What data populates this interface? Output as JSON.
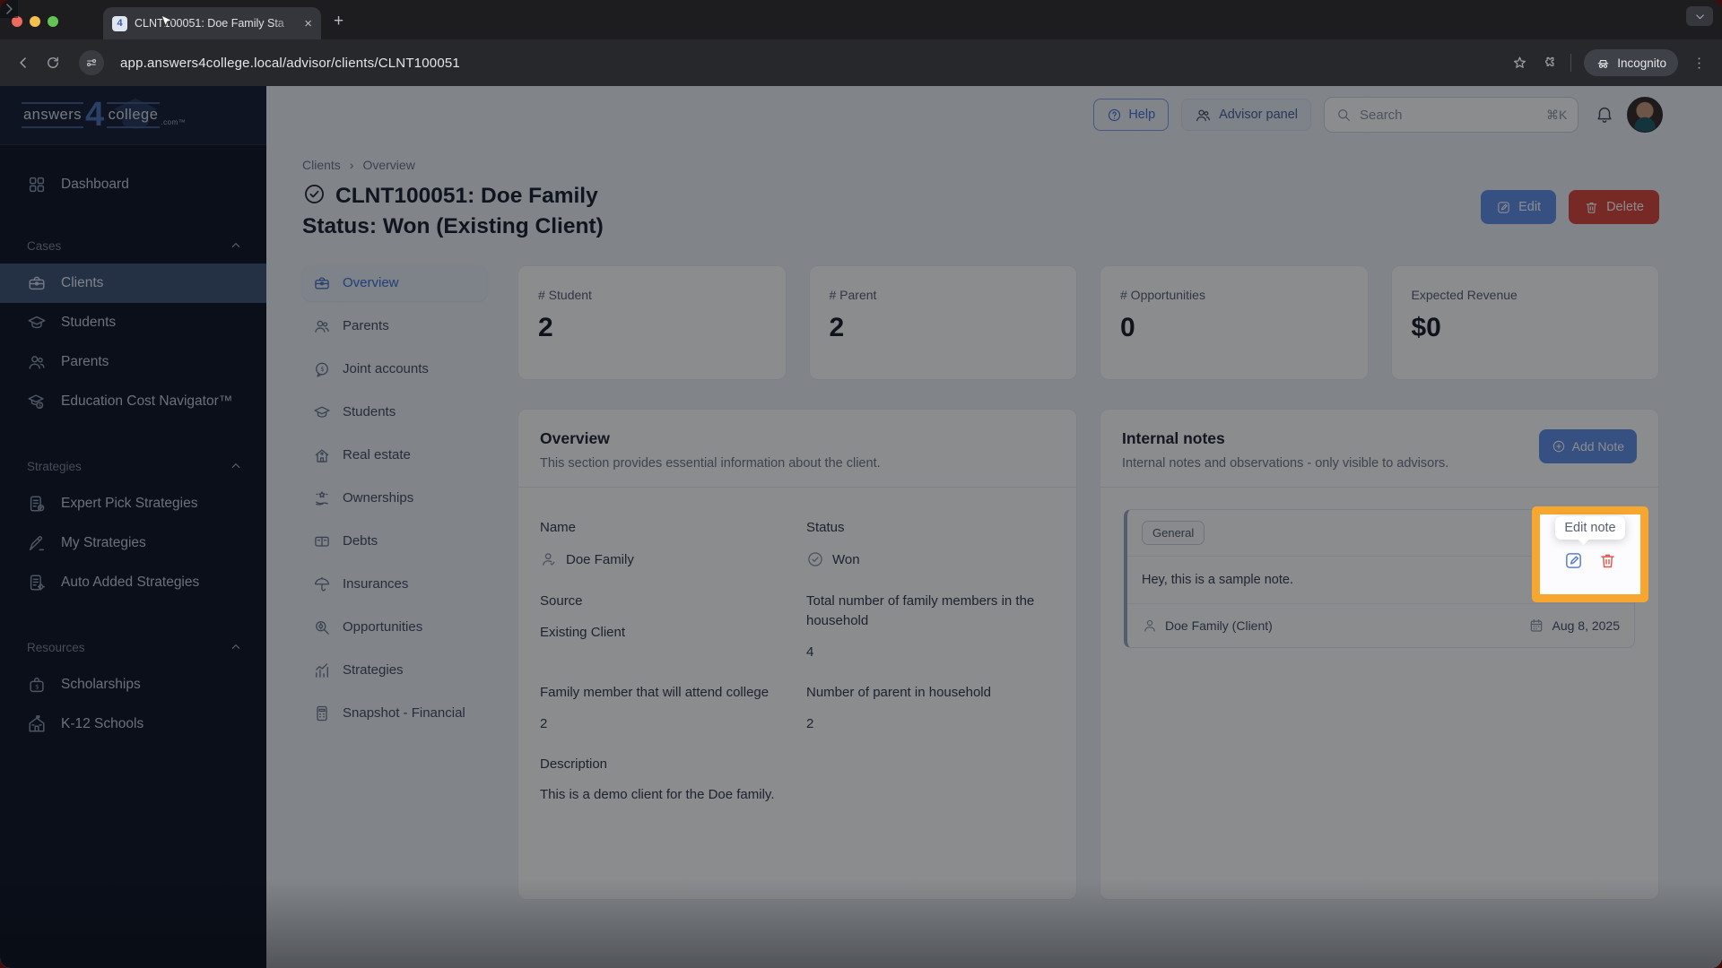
{
  "browser": {
    "tab_title": "CLNT100051: Doe Family Sta",
    "close_tab": "×",
    "url": "app.answers4college.local/advisor/clients/CLNT100051",
    "incognito_label": "Incognito"
  },
  "logo": {
    "part1": "answers",
    "part2": "4",
    "part3": "college",
    "part4": ".com™"
  },
  "header": {
    "help_label": "Help",
    "advisor_panel_label": "Advisor panel",
    "search_placeholder": "Search",
    "search_shortcut": "⌘K"
  },
  "sidebar": {
    "dashboard_label": "Dashboard",
    "sections": [
      {
        "label": "Cases",
        "items": [
          {
            "label": "Clients"
          },
          {
            "label": "Students"
          },
          {
            "label": "Parents"
          },
          {
            "label": "Education Cost Navigator™"
          }
        ]
      },
      {
        "label": "Strategies",
        "items": [
          {
            "label": "Expert Pick Strategies"
          },
          {
            "label": "My Strategies"
          },
          {
            "label": "Auto Added Strategies"
          }
        ]
      },
      {
        "label": "Resources",
        "items": [
          {
            "label": "Scholarships"
          },
          {
            "label": "K-12 Schools"
          }
        ]
      }
    ]
  },
  "breadcrumb": {
    "items": [
      "Clients",
      "Overview"
    ],
    "separator": "›"
  },
  "page": {
    "title_line1": "CLNT100051: Doe Family",
    "title_line2": "Status: Won (Existing Client)",
    "edit_label": "Edit",
    "delete_label": "Delete"
  },
  "subnav": {
    "items": [
      "Overview",
      "Parents",
      "Joint accounts",
      "Students",
      "Real estate",
      "Ownerships",
      "Debts",
      "Insurances",
      "Opportunities",
      "Strategies",
      "Snapshot - Financial"
    ]
  },
  "stats": [
    {
      "label": "# Student",
      "value": "2"
    },
    {
      "label": "# Parent",
      "value": "2"
    },
    {
      "label": "# Opportunities",
      "value": "0"
    },
    {
      "label": "Expected Revenue",
      "value": "$0"
    }
  ],
  "overview_card": {
    "title": "Overview",
    "subtitle": "This section provides essential information about the client.",
    "fields": {
      "name_label": "Name",
      "name_value": "Doe Family",
      "status_label": "Status",
      "status_value": "Won",
      "source_label": "Source",
      "source_value": "Existing Client",
      "family_total_label": "Total number of family members in the household",
      "family_total_value": "4",
      "attend_label": "Family member that will attend college",
      "attend_value": "2",
      "parents_label": "Number of parent in household",
      "parents_value": "2",
      "description_label": "Description",
      "description_value": "This is a demo client for the Doe family."
    }
  },
  "notes_card": {
    "title": "Internal notes",
    "subtitle": "Internal notes and observations - only visible to advisors.",
    "add_note_label": "Add Note",
    "note": {
      "tag": "General",
      "text": "Hey, this is a sample note.",
      "author": "Doe Family (Client)",
      "date": "Aug 8, 2025"
    }
  },
  "tooltip": {
    "label": "Edit note"
  },
  "colors": {
    "accent_blue": "#5e8fe8",
    "danger_red": "#d9453a",
    "highlight_orange": "#f7a72f",
    "sidebar_bg": "#0b1322"
  }
}
